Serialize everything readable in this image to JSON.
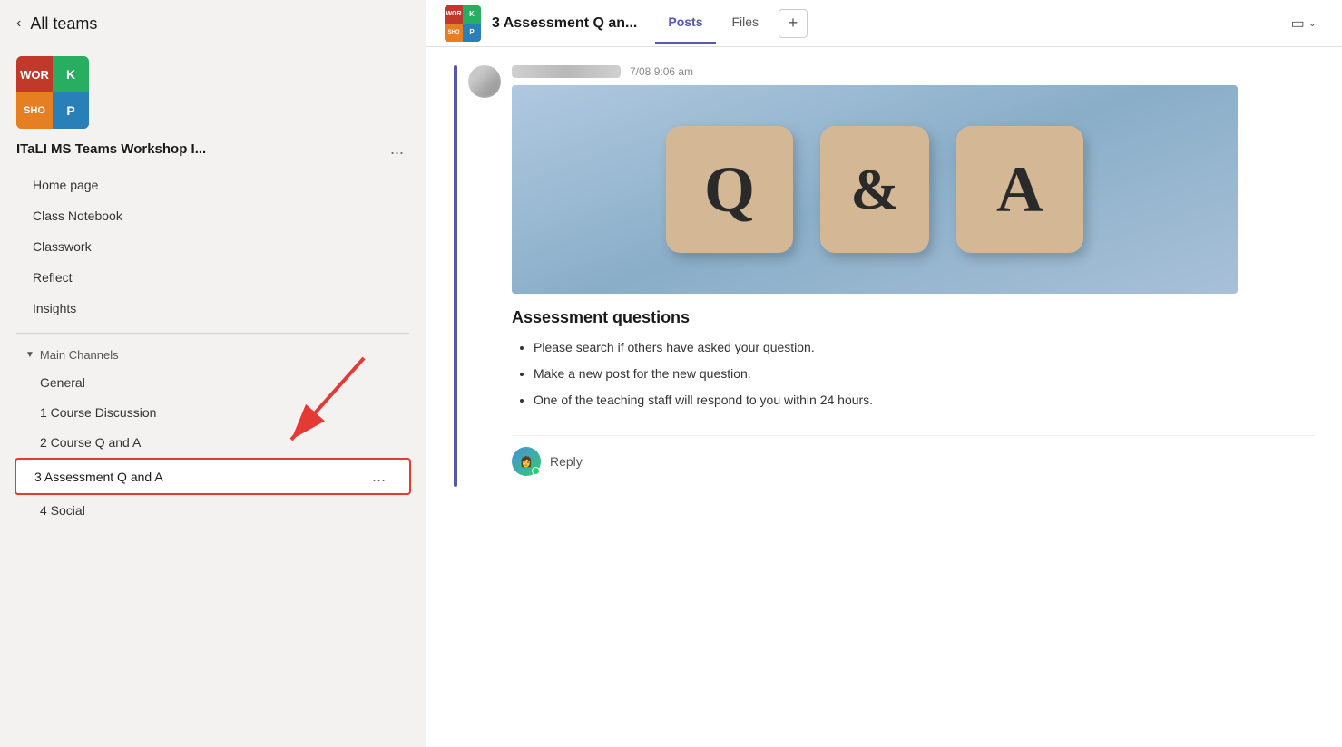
{
  "sidebar": {
    "all_teams_label": "All teams",
    "team_name": "ITaLI MS Teams Workshop I...",
    "logo_text": [
      "WOR",
      "K",
      "SHO",
      "P"
    ],
    "nav_items": [
      {
        "id": "home",
        "label": "Home page"
      },
      {
        "id": "class-notebook",
        "label": "Class Notebook"
      },
      {
        "id": "classwork",
        "label": "Classwork"
      },
      {
        "id": "reflect",
        "label": "Reflect"
      },
      {
        "id": "insights",
        "label": "Insights"
      }
    ],
    "channels_header": "Main Channels",
    "channels": [
      {
        "id": "general",
        "label": "General"
      },
      {
        "id": "course-discussion",
        "label": "1 Course Discussion"
      },
      {
        "id": "course-qa",
        "label": "2 Course Q and A"
      },
      {
        "id": "assessment-qa",
        "label": "3 Assessment Q and A",
        "selected": true
      },
      {
        "id": "social",
        "label": "4 Social"
      }
    ]
  },
  "header": {
    "channel_title": "3 Assessment Q an...",
    "tabs": [
      {
        "id": "posts",
        "label": "Posts",
        "active": true
      },
      {
        "id": "files",
        "label": "Files"
      }
    ],
    "tab_add_label": "+",
    "video_icon": "📹"
  },
  "message": {
    "timestamp": "7/08 9:06 am",
    "qa_image_alt": "Q&A wooden blocks",
    "qa_blocks": [
      "Q",
      "&",
      "A"
    ],
    "post_title": "Assessment questions",
    "bullets": [
      "Please search if others have asked your question.",
      "Make a new post for the new question.",
      "One of the teaching staff will respond to you within 24 hours."
    ],
    "reply_label": "Reply"
  },
  "more_btn_label": "...",
  "chevron_left": "<"
}
